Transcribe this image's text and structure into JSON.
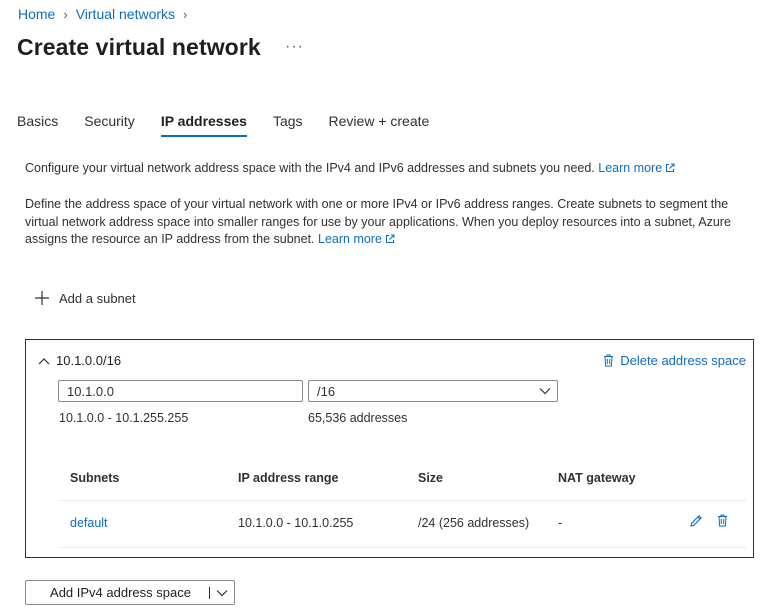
{
  "breadcrumb": {
    "home": "Home",
    "parent": "Virtual networks"
  },
  "title": "Create virtual network",
  "more_label": "···",
  "tabs": [
    {
      "label": "Basics",
      "active": false
    },
    {
      "label": "Security",
      "active": false
    },
    {
      "label": "IP addresses",
      "active": true
    },
    {
      "label": "Tags",
      "active": false
    },
    {
      "label": "Review + create",
      "active": false
    }
  ],
  "intro": {
    "text": "Configure your virtual network address space with the IPv4 and IPv6 addresses and subnets you need. ",
    "link": "Learn more"
  },
  "description": {
    "text": "Define the address space of your virtual network with one or more IPv4 or IPv6 address ranges. Create subnets to segment the virtual network address space into smaller ranges for use by your applications. When you deploy resources into a subnet, Azure assigns the resource an IP address from the subnet. ",
    "link": "Learn more"
  },
  "add_subnet_label": "Add a subnet",
  "address_space": {
    "header": "10.1.0.0/16",
    "delete_label": "Delete address space",
    "ip_value": "10.1.0.0",
    "prefix_value": "/16",
    "range_text": "10.1.0.0 - 10.1.255.255",
    "count_text": "65,536 addresses"
  },
  "subnets": {
    "columns": [
      "Subnets",
      "IP address range",
      "Size",
      "NAT gateway"
    ],
    "rows": [
      {
        "name": "default",
        "range": "10.1.0.0 - 10.1.0.255",
        "size": "/24 (256 addresses)",
        "nat": "-"
      }
    ]
  },
  "add_space_button": "Add IPv4 address space",
  "colors": {
    "accent": "#0f6cbd",
    "text": "#323130",
    "border": "#8a8886"
  },
  "icons": [
    "chevron-right-icon",
    "external-link-icon",
    "plus-icon",
    "chevron-up-icon",
    "trash-icon",
    "chevron-down-icon",
    "pencil-icon"
  ]
}
